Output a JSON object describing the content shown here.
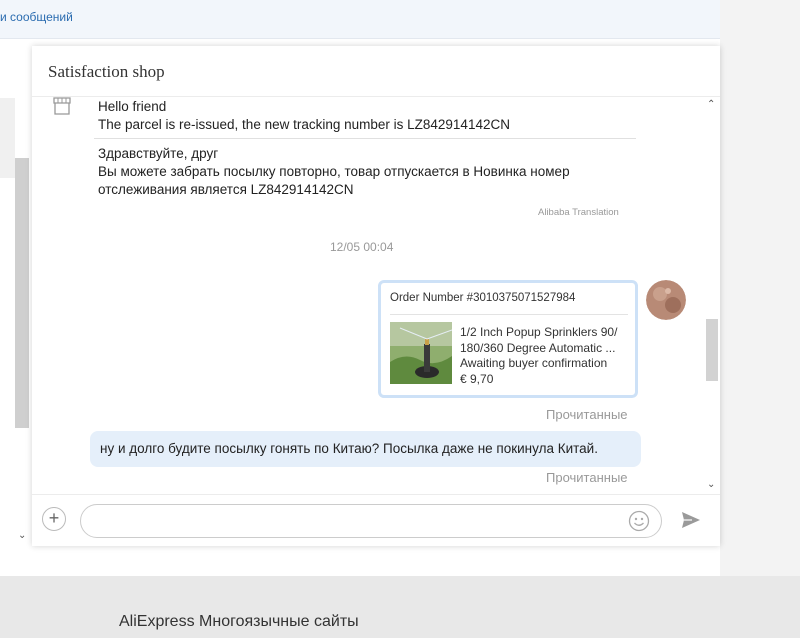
{
  "top_link": "и сообщений",
  "header": {
    "shop_name": "Satisfaction shop"
  },
  "messages": {
    "seller_en_line1": "Hello friend",
    "seller_en_line2": "The parcel is re-issued, the new tracking number is LZ842914142CN",
    "seller_ru_line1": "Здравствуйте, друг",
    "seller_ru_line2": "Вы можете забрать посылку повторно, товар отпускается в Новинка номер отслеживания является LZ842914142CN",
    "translation_label": "Alibaba Translation",
    "timestamp": "12/05 00:04",
    "order": {
      "number": "Order Number #3010375071527984",
      "product_title": "1/2 Inch Popup Sprinklers 90/ 180/360 Degree Automatic ...",
      "status": "Awaiting buyer confirmation",
      "price": "€ 9,70"
    },
    "read_label_1": "Прочитанные",
    "buyer_message": "ну и долго будите посылку гонять по Китаю? Посылка даже не покинула Китай.",
    "read_label_2": "Прочитанные"
  },
  "input": {
    "placeholder": ""
  },
  "icons": {
    "add": "plus-icon",
    "emoji": "smiley-icon",
    "send": "send-icon",
    "shop": "shop-icon"
  },
  "footer": {
    "text": "AliExpress Многоязычные сайты"
  },
  "colors": {
    "bubble": "#e5effa",
    "order_border": "#cde1f7",
    "muted": "#999999"
  }
}
